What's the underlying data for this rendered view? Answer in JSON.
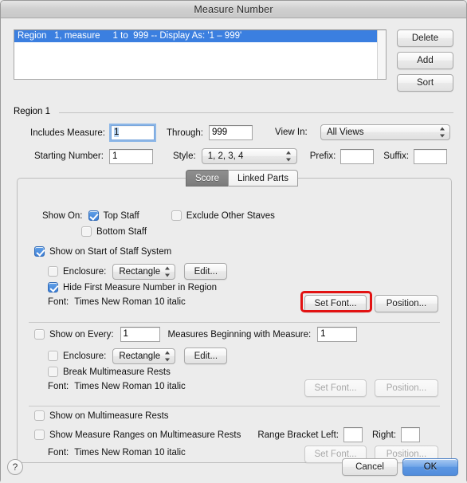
{
  "window": {
    "title": "Measure Number"
  },
  "list": {
    "rows": [
      "Region   1, measure     1 to  999 -- Display As: '1 – 999'"
    ]
  },
  "side_buttons": {
    "delete": "Delete",
    "add": "Add",
    "sort": "Sort"
  },
  "region": {
    "group_label": "Region 1",
    "includes_measure_label": "Includes Measure:",
    "includes_measure_value": "1",
    "through_label": "Through:",
    "through_value": "999",
    "view_in_label": "View In:",
    "view_in_value": "All Views",
    "starting_number_label": "Starting Number:",
    "starting_number_value": "1",
    "style_label": "Style:",
    "style_value": "1, 2, 3, 4",
    "prefix_label": "Prefix:",
    "prefix_value": "",
    "suffix_label": "Suffix:",
    "suffix_value": ""
  },
  "tabs": [
    {
      "label": "Score",
      "active": true
    },
    {
      "label": "Linked Parts",
      "active": false
    }
  ],
  "section_staff": {
    "show_on_label": "Show On:",
    "top_staff_label": "Top Staff",
    "top_staff_checked": true,
    "exclude_other_staves_label": "Exclude Other Staves",
    "exclude_other_staves_checked": false,
    "bottom_staff_label": "Bottom Staff",
    "bottom_staff_checked": false
  },
  "section_start_of_system": {
    "title_label": "Show on Start of Staff System",
    "title_checked": true,
    "enclosure_label": "Enclosure:",
    "enclosure_checked": false,
    "enclosure_value": "Rectangle",
    "edit_button": "Edit...",
    "hide_first_label": "Hide First Measure Number in Region",
    "hide_first_checked": true,
    "font_label": "Font:",
    "font_value": "Times New Roman 10 italic",
    "set_font_button": "Set Font...",
    "position_button": "Position...",
    "set_font_highlighted": true
  },
  "section_show_on_every": {
    "title_label": "Show on Every:",
    "title_checked": false,
    "every_value": "1",
    "measures_beginning_label": "Measures Beginning with Measure:",
    "measures_beginning_value": "1",
    "enclosure_label": "Enclosure:",
    "enclosure_checked": false,
    "enclosure_value": "Rectangle",
    "edit_button": "Edit...",
    "break_multimeasure_label": "Break Multimeasure Rests",
    "break_multimeasure_checked": false,
    "font_label": "Font:",
    "font_value": "Times New Roman 10 italic",
    "set_font_button": "Set Font...",
    "position_button": "Position..."
  },
  "section_multimeasure": {
    "show_on_multimeasure_label": "Show on Multimeasure Rests",
    "show_on_multimeasure_checked": false,
    "show_ranges_label": "Show Measure Ranges on Multimeasure Rests",
    "show_ranges_checked": false,
    "range_bracket_left_label": "Range Bracket Left:",
    "range_bracket_left_value": "",
    "range_bracket_right_label": "Right:",
    "range_bracket_right_value": "",
    "font_label": "Font:",
    "font_value": "Times New Roman 10 italic",
    "set_font_button": "Set Font...",
    "position_button": "Position..."
  },
  "footer": {
    "help": "?",
    "cancel": "Cancel",
    "ok": "OK"
  },
  "colors": {
    "selection_blue": "#3b7fe0",
    "default_button_blue": "#5b96e2",
    "highlight_red": "#e21212",
    "checkbox_blue": "#3d7fd6"
  }
}
